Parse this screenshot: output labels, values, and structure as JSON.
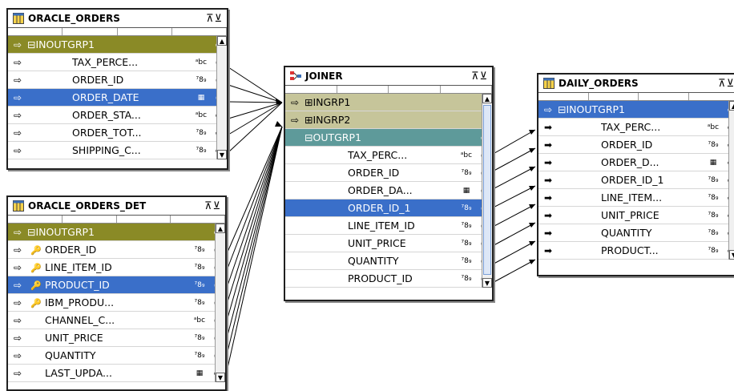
{
  "colors": {
    "selected": "#3a6fc9",
    "group_row": "#c6c59a",
    "group_olive": "#8a8a26",
    "group_teal": "#5e9a9a"
  },
  "oracle_orders": {
    "title": "ORACLE_ORDERS",
    "group": "INOUTGRP1",
    "fields": [
      {
        "name": "TAX_PERCE...",
        "type": "abc"
      },
      {
        "name": "ORDER_ID",
        "type": "789"
      },
      {
        "name": "ORDER_DATE",
        "type": "date"
      },
      {
        "name": "ORDER_STA...",
        "type": "abc"
      },
      {
        "name": "ORDER_TOT...",
        "type": "789"
      },
      {
        "name": "SHIPPING_C...",
        "type": "789"
      }
    ]
  },
  "oracle_orders_det": {
    "title": "ORACLE_ORDERS_DET",
    "group": "INOUTGRP1",
    "fields": [
      {
        "name": "ORDER_ID",
        "type": "789"
      },
      {
        "name": "LINE_ITEM_ID",
        "type": "789"
      },
      {
        "name": "PRODUCT_ID",
        "type": "789"
      },
      {
        "name": "IBM_PRODU...",
        "type": "789"
      },
      {
        "name": "CHANNEL_C...",
        "type": "abc"
      },
      {
        "name": "UNIT_PRICE",
        "type": "789"
      },
      {
        "name": "QUANTITY",
        "type": "789"
      },
      {
        "name": "LAST_UPDA...",
        "type": "date"
      }
    ]
  },
  "joiner": {
    "title": "JOINER",
    "groups": [
      "INGRP1",
      "INGRP2",
      "OUTGRP1"
    ],
    "fields": [
      {
        "name": "TAX_PERC...",
        "type": "abc"
      },
      {
        "name": "ORDER_ID",
        "type": "789"
      },
      {
        "name": "ORDER_DA...",
        "type": "date"
      },
      {
        "name": "ORDER_ID_1",
        "type": "789"
      },
      {
        "name": "LINE_ITEM_ID",
        "type": "789"
      },
      {
        "name": "UNIT_PRICE",
        "type": "789"
      },
      {
        "name": "QUANTITY",
        "type": "789"
      },
      {
        "name": "PRODUCT_ID",
        "type": "789"
      }
    ]
  },
  "daily_orders": {
    "title": "DAILY_ORDERS",
    "group": "INOUTGRP1",
    "fields": [
      {
        "name": "TAX_PERC...",
        "type": "abc"
      },
      {
        "name": "ORDER_ID",
        "type": "789"
      },
      {
        "name": "ORDER_D...",
        "type": "date"
      },
      {
        "name": "ORDER_ID_1",
        "type": "789"
      },
      {
        "name": "LINE_ITEM...",
        "type": "789"
      },
      {
        "name": "UNIT_PRICE",
        "type": "789"
      },
      {
        "name": "QUANTITY",
        "type": "789"
      },
      {
        "name": "PRODUCT...",
        "type": "789"
      }
    ]
  },
  "glyphs": {
    "abc": "ᵃbc",
    "789": "⁷8₉",
    "date": "▦"
  }
}
